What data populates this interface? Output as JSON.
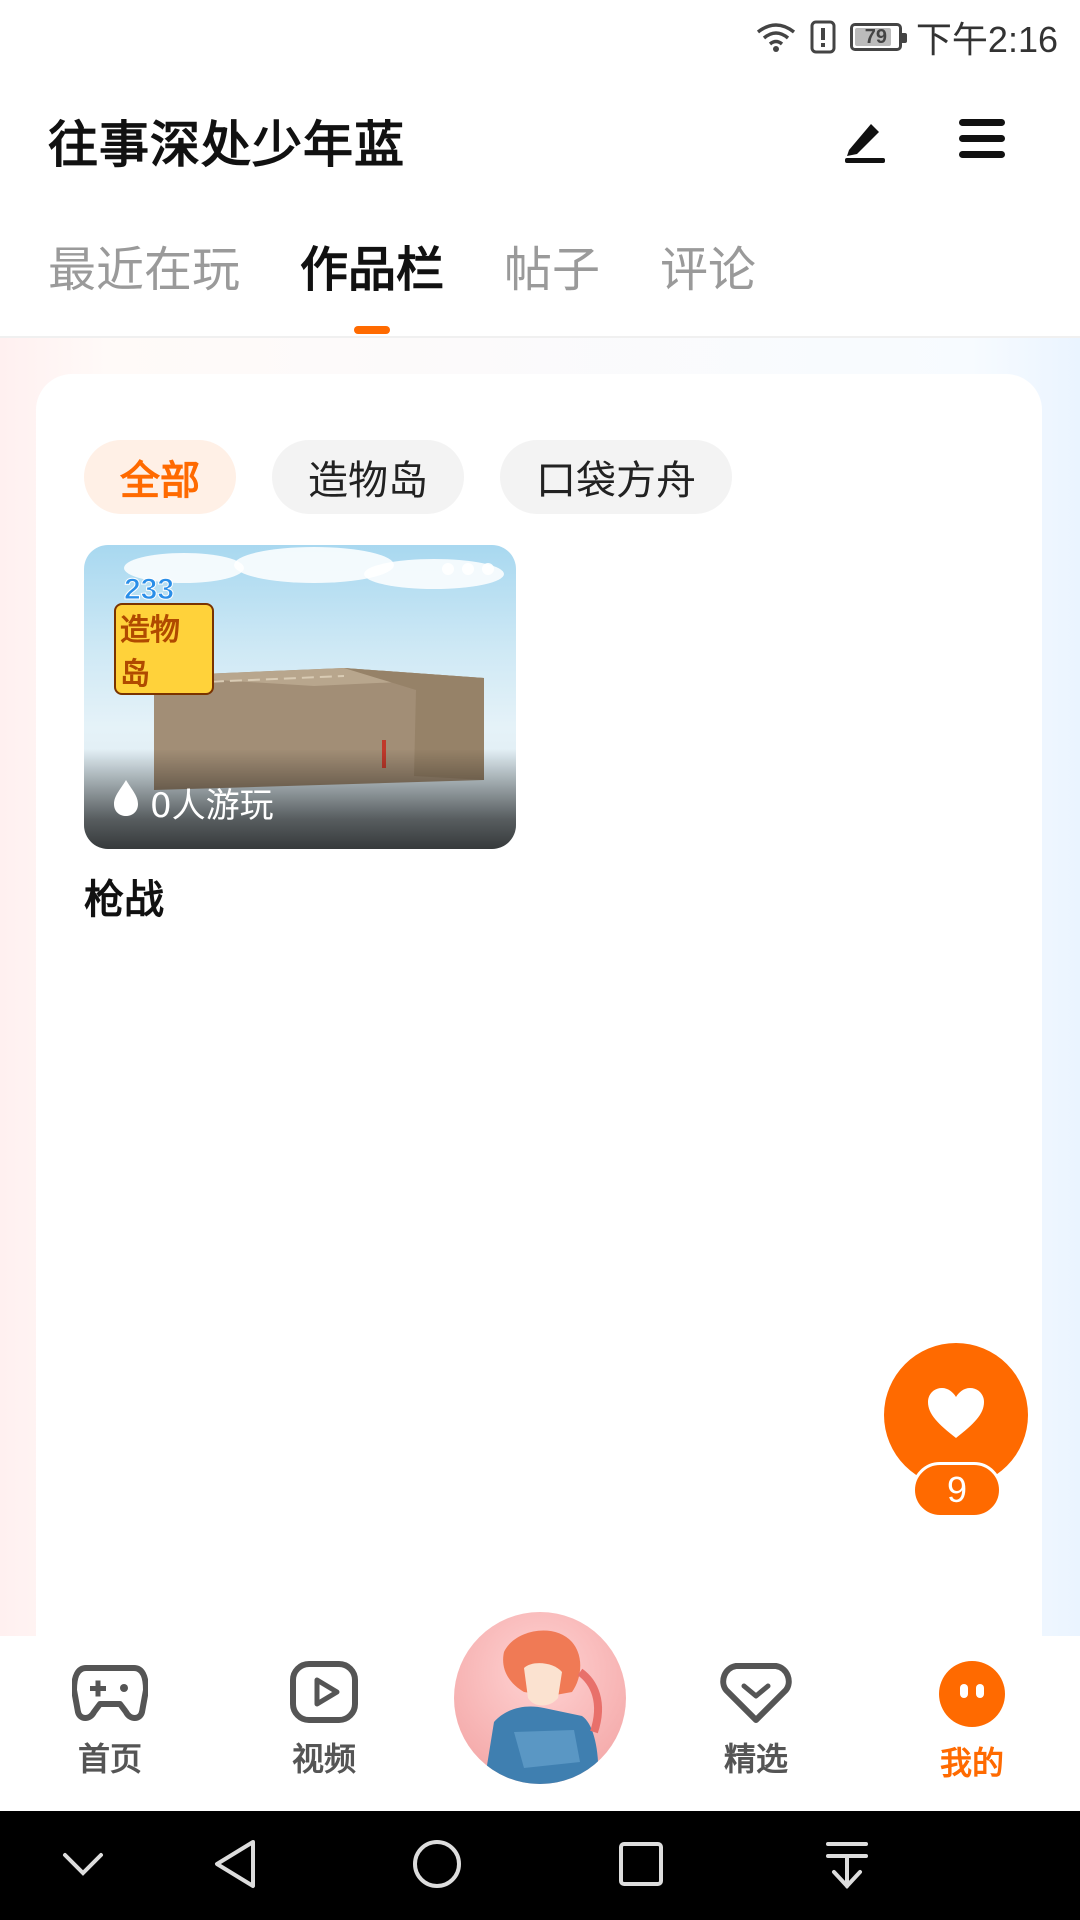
{
  "status_bar": {
    "battery_level": "79",
    "time": "下午2:16",
    "icons": [
      "wifi-icon",
      "alert-icon",
      "battery-icon"
    ]
  },
  "header": {
    "title": "往事深处少年蓝",
    "icons": [
      "edit-icon",
      "menu-icon"
    ]
  },
  "tabs": [
    {
      "label": "最近在玩",
      "active": false
    },
    {
      "label": "作品栏",
      "active": true
    },
    {
      "label": "帖子",
      "active": false
    },
    {
      "label": "评论",
      "active": false
    }
  ],
  "filter_chips": [
    {
      "label": "全部",
      "active": true
    },
    {
      "label": "造物岛",
      "active": false
    },
    {
      "label": "口袋方舟",
      "active": false
    }
  ],
  "works": [
    {
      "title": "枪战",
      "plays": "0人游玩",
      "logo_number": "233",
      "logo_text": "造物岛"
    }
  ],
  "like_button": {
    "count": "9",
    "icon": "heart-icon"
  },
  "bottom_nav": [
    {
      "label": "首页",
      "icon": "gamepad-icon",
      "active": false
    },
    {
      "label": "视频",
      "icon": "video-play-icon",
      "active": false
    },
    {
      "label": "精选",
      "icon": "heart-badge-icon",
      "active": false
    },
    {
      "label": "我的",
      "icon": "face-icon",
      "active": true
    }
  ],
  "colors": {
    "accent": "#ff6a00",
    "active_chip_bg": "#fff0e6",
    "inactive_tab": "#9a9a9a"
  }
}
